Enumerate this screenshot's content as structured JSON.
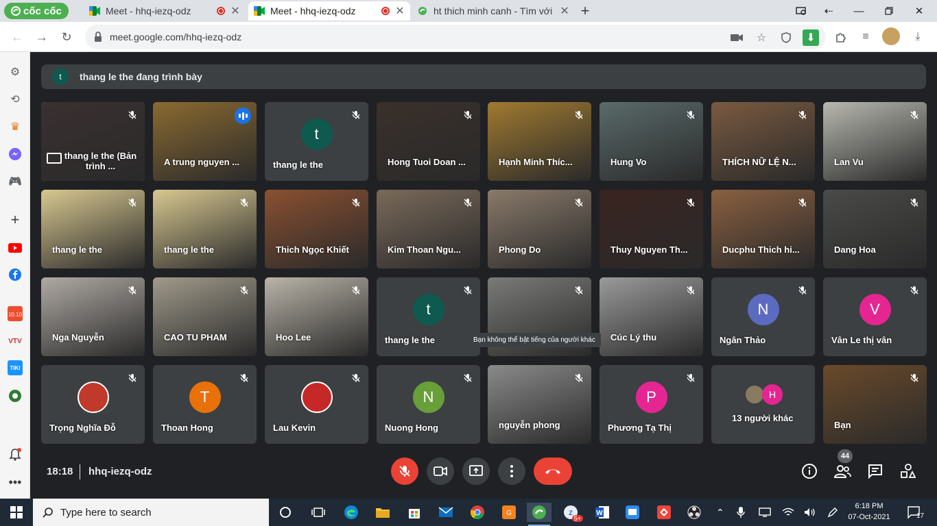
{
  "browser": {
    "brand": "cốc cốc",
    "tabs": [
      {
        "title": "Meet - hhq-iezq-odz",
        "recording": true,
        "active": false
      },
      {
        "title": "Meet - hhq-iezq-odz",
        "recording": true,
        "active": true
      },
      {
        "title": "ht thich minh canh - Tìm với",
        "recording": false,
        "active": false
      }
    ],
    "url": "meet.google.com/hhq-iezq-odz"
  },
  "meet": {
    "presenting_avatar": "t",
    "presenting_text": "thang le the đang trình bày",
    "tooltip": "Bạn không thể bật tiếng của người khác",
    "tiles": [
      {
        "name": "thang le the (Bản trình ...",
        "kind": "screen",
        "bg": "#3a3030"
      },
      {
        "name": "A trung nguyen ...",
        "kind": "video",
        "bg": "#8a6a30",
        "speaking": true
      },
      {
        "name": "thang le the",
        "kind": "avatar",
        "initial": "t",
        "avcolor": "#0e5a4e"
      },
      {
        "name": "Hong Tuoi Doan ...",
        "kind": "video",
        "bg": "#3a302a"
      },
      {
        "name": "Hạnh Minh Thíc...",
        "kind": "video",
        "bg": "#a07a30"
      },
      {
        "name": "Hung Vo",
        "kind": "video",
        "bg": "#5a6a6a"
      },
      {
        "name": "THÍCH NỮ LỆ N...",
        "kind": "video",
        "bg": "#7a5a40"
      },
      {
        "name": "Lan Vu",
        "kind": "video",
        "bg": "#b8b8b0"
      },
      {
        "name": "thang le the",
        "kind": "video",
        "bg": "#d8c890"
      },
      {
        "name": "thang le the",
        "kind": "video",
        "bg": "#d8c890"
      },
      {
        "name": "Thich Ngọc Khiết",
        "kind": "video",
        "bg": "#8a5030"
      },
      {
        "name": "Kim Thoan Ngu...",
        "kind": "video",
        "bg": "#7a6a5a"
      },
      {
        "name": "Phong Do",
        "kind": "video",
        "bg": "#8a7a6a"
      },
      {
        "name": "Thuy Nguyen Th...",
        "kind": "video",
        "bg": "#3a2420"
      },
      {
        "name": "Ducphu Thich hi...",
        "kind": "video",
        "bg": "#8a6040"
      },
      {
        "name": "Dang Hoa",
        "kind": "video",
        "bg": "#4a4a48"
      },
      {
        "name": "Nga Nguyễn",
        "kind": "video",
        "bg": "#b0aaa4"
      },
      {
        "name": "CAO TU PHAM",
        "kind": "video",
        "bg": "#a09a8a"
      },
      {
        "name": "Hoo Lee",
        "kind": "video",
        "bg": "#bab4a8"
      },
      {
        "name": "thang le the",
        "kind": "avatar",
        "initial": "t",
        "avcolor": "#0e5a4e"
      },
      {
        "name": "",
        "kind": "video",
        "bg": "#7a7a78"
      },
      {
        "name": "Cúc Lý thu",
        "kind": "video",
        "bg": "#9a9a9a"
      },
      {
        "name": "Ngân Thảo",
        "kind": "avatar",
        "initial": "N",
        "avcolor": "#5c6bc0"
      },
      {
        "name": "Vân Le thị vân",
        "kind": "avatar",
        "initial": "V",
        "avcolor": "#e52592"
      },
      {
        "name": "Trọng Nghĩa Đỗ",
        "kind": "photo",
        "avcolor": "#c0392b"
      },
      {
        "name": "Thoan Hong",
        "kind": "avatar",
        "initial": "T",
        "avcolor": "#e8710a"
      },
      {
        "name": "Lau Kevin",
        "kind": "photo",
        "avcolor": "#c62828"
      },
      {
        "name": "Nuong Hong",
        "kind": "avatar",
        "initial": "N",
        "avcolor": "#689f38"
      },
      {
        "name": "nguyễn phong",
        "kind": "video",
        "bg": "#8a8a8a"
      },
      {
        "name": "Phương Tạ Thị",
        "kind": "avatar",
        "initial": "P",
        "avcolor": "#e52592"
      },
      {
        "name": "13 người khác",
        "kind": "others",
        "initial": "H",
        "avcolor": "#e52592"
      },
      {
        "name": "Bạn",
        "kind": "video",
        "bg": "#6a4a2a"
      }
    ],
    "time": "18:18",
    "meeting_code": "hhq-iezq-odz",
    "participant_count": "44"
  },
  "taskbar": {
    "search_placeholder": "Type here to search",
    "time": "6:18 PM",
    "date": "07-Oct-2021",
    "notif_count": "17",
    "zalo_badge": "5+"
  },
  "colors": {
    "accent": "#1a73e8",
    "danger": "#ea4335",
    "tile": "#3c4043"
  }
}
